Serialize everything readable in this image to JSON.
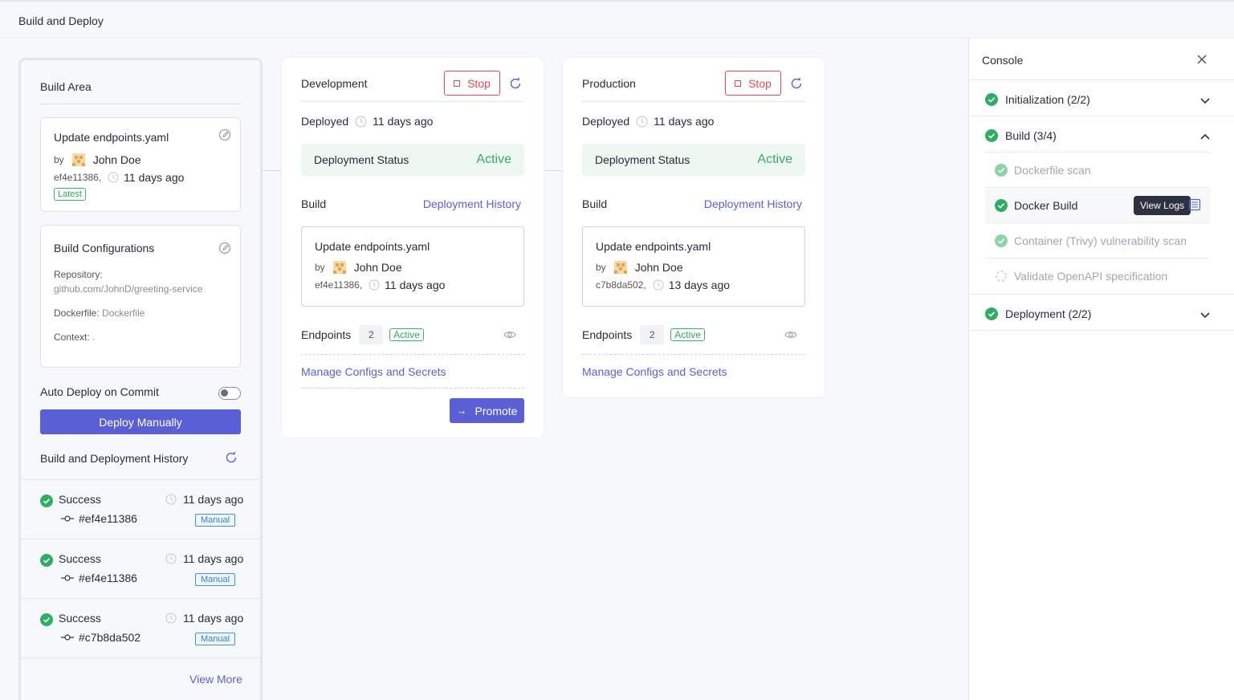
{
  "header": {
    "title": "Build and Deploy"
  },
  "build_area": {
    "title": "Build Area",
    "latest_commit": {
      "title": "Update endpoints.yaml",
      "by": "by",
      "author": "John Doe",
      "hash": "ef4e11386,",
      "time": "11 days ago",
      "badge": "Latest"
    },
    "config": {
      "title": "Build Configurations",
      "repository_label": "Repository:",
      "repository_value": "github.com/JohnD/greeting-service",
      "dockerfile_label": "Dockerfile:",
      "dockerfile_value": "Dockerfile",
      "context_label": "Context:",
      "context_value": "."
    },
    "auto_deploy_label": "Auto Deploy on Commit",
    "deploy_button": "Deploy Manually",
    "history_title": "Build and Deployment History",
    "history": [
      {
        "status": "Success",
        "time": "11 days ago",
        "commit": "#ef4e11386",
        "badge": "Manual"
      },
      {
        "status": "Success",
        "time": "11 days ago",
        "commit": "#ef4e11386",
        "badge": "Manual"
      },
      {
        "status": "Success",
        "time": "11 days ago",
        "commit": "#c7b8da502",
        "badge": "Manual"
      }
    ],
    "view_more": "View More"
  },
  "environments": [
    {
      "name": "Development",
      "stop_label": "Stop",
      "deployed_label": "Deployed",
      "deployed_time": "11 days ago",
      "status_label": "Deployment Status",
      "status_value": "Active",
      "build_label": "Build",
      "history_link": "Deployment History",
      "commit": {
        "title": "Update endpoints.yaml",
        "by": "by",
        "author": "John Doe",
        "hash": "ef4e11386,",
        "time": "11 days ago"
      },
      "endpoints_label": "Endpoints",
      "endpoints_count": "2",
      "endpoints_status": "Active",
      "manage_link": "Manage Configs and Secrets",
      "promote_label": "Promote"
    },
    {
      "name": "Production",
      "stop_label": "Stop",
      "deployed_label": "Deployed",
      "deployed_time": "11 days ago",
      "status_label": "Deployment Status",
      "status_value": "Active",
      "build_label": "Build",
      "history_link": "Deployment History",
      "commit": {
        "title": "Update endpoints.yaml",
        "by": "by",
        "author": "John Doe",
        "hash": "c7b8da502,",
        "time": "13 days ago"
      },
      "endpoints_label": "Endpoints",
      "endpoints_count": "2",
      "endpoints_status": "Active",
      "manage_link": "Manage Configs and Secrets"
    }
  ],
  "console": {
    "title": "Console",
    "stages": [
      {
        "label": "Initialization (2/2)",
        "expanded": false
      },
      {
        "label": "Build (3/4)",
        "expanded": true
      },
      {
        "label": "Deployment (2/2)",
        "expanded": false
      }
    ],
    "build_steps": [
      {
        "label": "Dockerfile scan",
        "state": "done"
      },
      {
        "label": "Docker Build",
        "state": "done-active"
      },
      {
        "label": "Container (Trivy) vulnerability scan",
        "state": "done"
      },
      {
        "label": "Validate OpenAPI specification",
        "state": "pending"
      }
    ],
    "tooltip": "View Logs"
  },
  "colors": {
    "accent": "#5a5fd6",
    "success": "#3aa864",
    "danger": "#e5484d"
  }
}
